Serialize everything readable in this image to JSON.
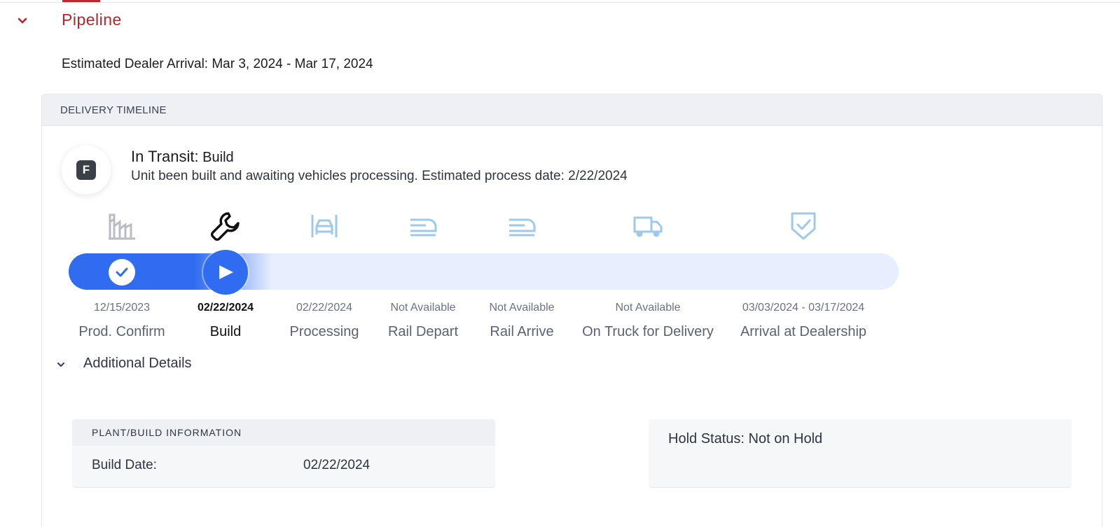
{
  "pipeline": {
    "title": "Pipeline",
    "toggle_icon": "chevron-down-icon",
    "accent_color": "#b3262d"
  },
  "dealer_arrival": {
    "label": "Estimated Dealer Arrival:",
    "value": "Mar 3, 2024 - Mar 17, 2024"
  },
  "timeline": {
    "header": "DELIVERY TIMELINE",
    "brand_badge_letter": "F",
    "status_label": "In Transit:",
    "status_value": "Build",
    "description": "Unit been built and awaiting vehicles processing. Estimated process date: 2/22/2024",
    "progress_color": "#2f6cf0",
    "track_color": "#e7eefd",
    "steps": [
      {
        "label": "Prod. Confirm",
        "date": "12/15/2023",
        "icon": "factory-icon",
        "state": "completed"
      },
      {
        "label": "Build",
        "date": "02/22/2024",
        "icon": "wrench-icon",
        "state": "current"
      },
      {
        "label": "Processing",
        "date": "02/22/2024",
        "icon": "car-processing-icon",
        "state": "pending"
      },
      {
        "label": "Rail Depart",
        "date": "Not Available",
        "icon": "train-icon",
        "state": "pending"
      },
      {
        "label": "Rail Arrive",
        "date": "Not Available",
        "icon": "train-icon",
        "state": "pending"
      },
      {
        "label": "On Truck for Delivery",
        "date": "Not Available",
        "icon": "truck-icon",
        "state": "pending"
      },
      {
        "label": "Arrival at Dealership",
        "date": "03/03/2024 - 03/17/2024",
        "icon": "shield-check-icon",
        "state": "pending"
      }
    ]
  },
  "additional_details": {
    "title": "Additional Details",
    "plant": {
      "header": "PLANT/BUILD INFORMATION",
      "build_date_label": "Build Date:",
      "build_date_value": "02/22/2024"
    },
    "hold": {
      "label": "Hold Status:",
      "value": "Not on Hold"
    }
  }
}
